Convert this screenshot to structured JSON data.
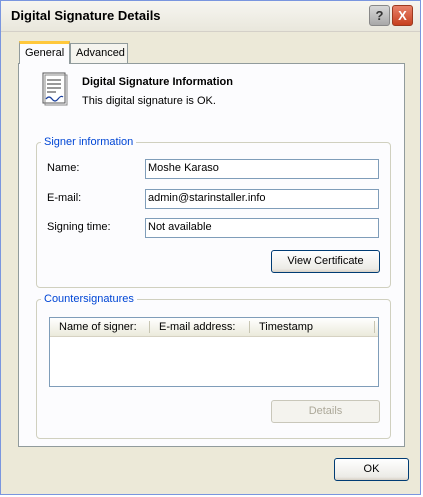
{
  "window": {
    "title": "Digital Signature Details"
  },
  "titlebar_buttons": {
    "help": "?",
    "close": "X"
  },
  "tabs": [
    {
      "label": "General",
      "active": true
    },
    {
      "label": "Advanced",
      "active": false
    }
  ],
  "info": {
    "icon": "signed-document-icon",
    "title": "Digital Signature Information",
    "status": "This digital signature is OK."
  },
  "signer": {
    "legend": "Signer information",
    "name_label": "Name:",
    "name_value": "Moshe Karaso",
    "email_label": "E-mail:",
    "email_value": "admin@starinstaller.info",
    "time_label": "Signing time:",
    "time_value": "Not available",
    "view_certificate": "View Certificate"
  },
  "countersignatures": {
    "legend": "Countersignatures",
    "columns": [
      "Name of signer:",
      "E-mail address:",
      "Timestamp"
    ],
    "rows": [],
    "details_button": "Details"
  },
  "ok_button": "OK",
  "colors": {
    "accent_legend": "#0046d5",
    "active_tab_highlight": "#ffc83c",
    "window_bg": "#ece9d8",
    "button_border": "#003c74"
  }
}
